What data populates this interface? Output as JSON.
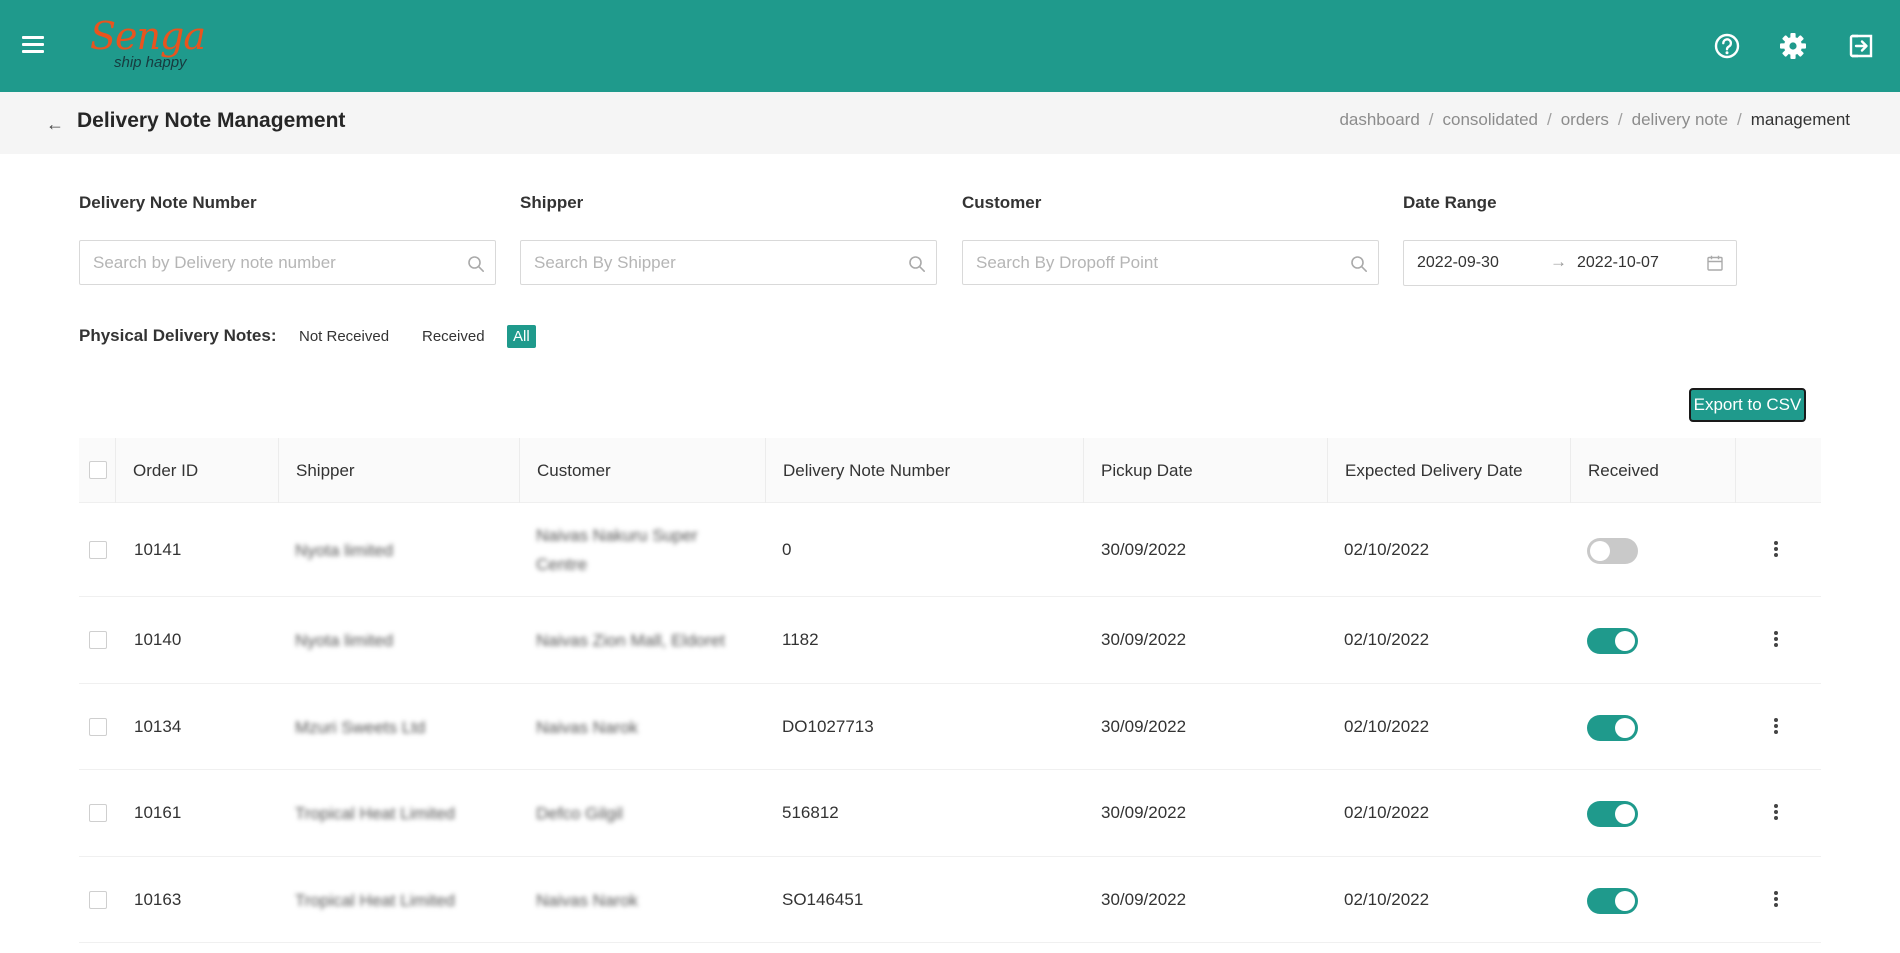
{
  "header": {
    "logo_word": "enga",
    "logo_s": "S",
    "logo_tagline": "ship happy",
    "icons": [
      "menu-icon",
      "help-icon",
      "gear-icon",
      "logout-icon"
    ]
  },
  "subheader": {
    "title": "Delivery Note Management",
    "breadcrumb": [
      "dashboard",
      "consolidated",
      "orders",
      "delivery note",
      "management"
    ]
  },
  "filters": {
    "delivery_note": {
      "label": "Delivery Note Number",
      "placeholder": "Search by Delivery note number"
    },
    "shipper": {
      "label": "Shipper",
      "placeholder": "Search By Shipper"
    },
    "customer": {
      "label": "Customer",
      "placeholder": "Search By Dropoff Point"
    },
    "date_range": {
      "label": "Date Range",
      "start": "2022-09-30",
      "end": "2022-10-07",
      "separator": "→"
    }
  },
  "physical": {
    "label": "Physical Delivery Notes:",
    "options": [
      "Not Received",
      "Received",
      "All"
    ],
    "selected": "All"
  },
  "export_label": "Export to CSV",
  "table": {
    "columns": [
      "Order ID",
      "Shipper",
      "Customer",
      "Delivery Note Number",
      "Pickup Date",
      "Expected Delivery Date",
      "Received"
    ],
    "rows": [
      {
        "order_id": "10141",
        "shipper": "Nyota limited",
        "customer": "Naivas Nakuru Super Centre",
        "dn": "0",
        "pickup": "30/09/2022",
        "expected": "02/10/2022",
        "received": false
      },
      {
        "order_id": "10140",
        "shipper": "Nyota limited",
        "customer": "Naivas Zion Mall, Eldoret",
        "dn": "1182",
        "pickup": "30/09/2022",
        "expected": "02/10/2022",
        "received": true
      },
      {
        "order_id": "10134",
        "shipper": "Mzuri Sweets Ltd",
        "customer": "Naivas Narok",
        "dn": "DO1027713",
        "pickup": "30/09/2022",
        "expected": "02/10/2022",
        "received": true
      },
      {
        "order_id": "10161",
        "shipper": "Tropical Heat Limited",
        "customer": "Defco Gilgil",
        "dn": "516812",
        "pickup": "30/09/2022",
        "expected": "02/10/2022",
        "received": true
      },
      {
        "order_id": "10163",
        "shipper": "Tropical Heat Limited",
        "customer": "Naivas Narok",
        "dn": "SO146451",
        "pickup": "30/09/2022",
        "expected": "02/10/2022",
        "received": true
      }
    ]
  },
  "colors": {
    "brand": "#1f9a8c",
    "logo_orange": "#e8541e"
  }
}
